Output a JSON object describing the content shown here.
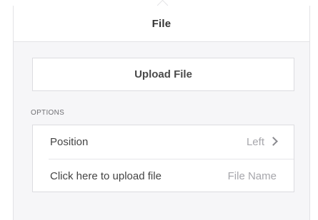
{
  "header": {
    "title": "File"
  },
  "upload": {
    "label": "Upload File"
  },
  "options": {
    "section_label": "OPTIONS",
    "rows": [
      {
        "label": "Position",
        "value": "Left",
        "icon": "chevron-right-icon"
      },
      {
        "label": "Click here to upload file",
        "value": "File Name"
      }
    ]
  }
}
